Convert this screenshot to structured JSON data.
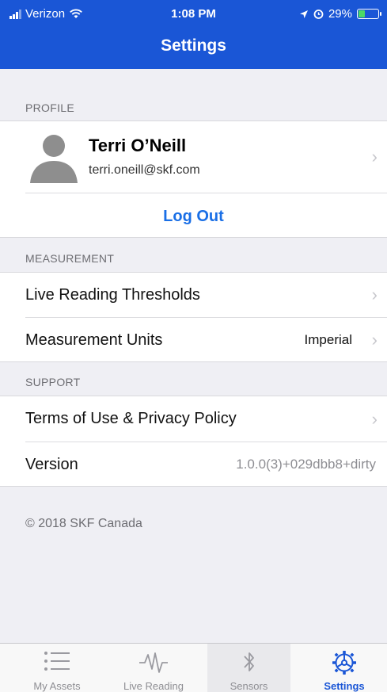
{
  "status_bar": {
    "carrier": "Verizon",
    "time": "1:08 PM",
    "battery": "29%"
  },
  "header": {
    "title": "Settings"
  },
  "profile_section": {
    "header": "PROFILE",
    "name": "Terri O’Neill",
    "email": "terri.oneill@skf.com",
    "logout_label": "Log Out"
  },
  "measurement_section": {
    "header": "MEASUREMENT",
    "thresholds_label": "Live Reading Thresholds",
    "units_label": "Measurement Units",
    "units_value": "Imperial"
  },
  "support_section": {
    "header": "SUPPORT",
    "terms_label": "Terms of Use & Privacy Policy",
    "version_label": "Version",
    "version_value": "1.0.0(3)+029dbb8+dirty"
  },
  "footer": {
    "copyright": "© 2018 SKF Canada"
  },
  "tabbar": {
    "tabs": [
      {
        "label": "My Assets",
        "icon": "list-icon"
      },
      {
        "label": "Live Reading",
        "icon": "waveform-icon"
      },
      {
        "label": "Sensors",
        "icon": "bluetooth-icon"
      },
      {
        "label": "Settings",
        "icon": "settings-gear-icon"
      }
    ],
    "active_index": 3
  },
  "colors": {
    "accent": "#1a56d6",
    "link": "#1a6fe6",
    "background": "#efeff4",
    "battery": "#4cd964"
  }
}
